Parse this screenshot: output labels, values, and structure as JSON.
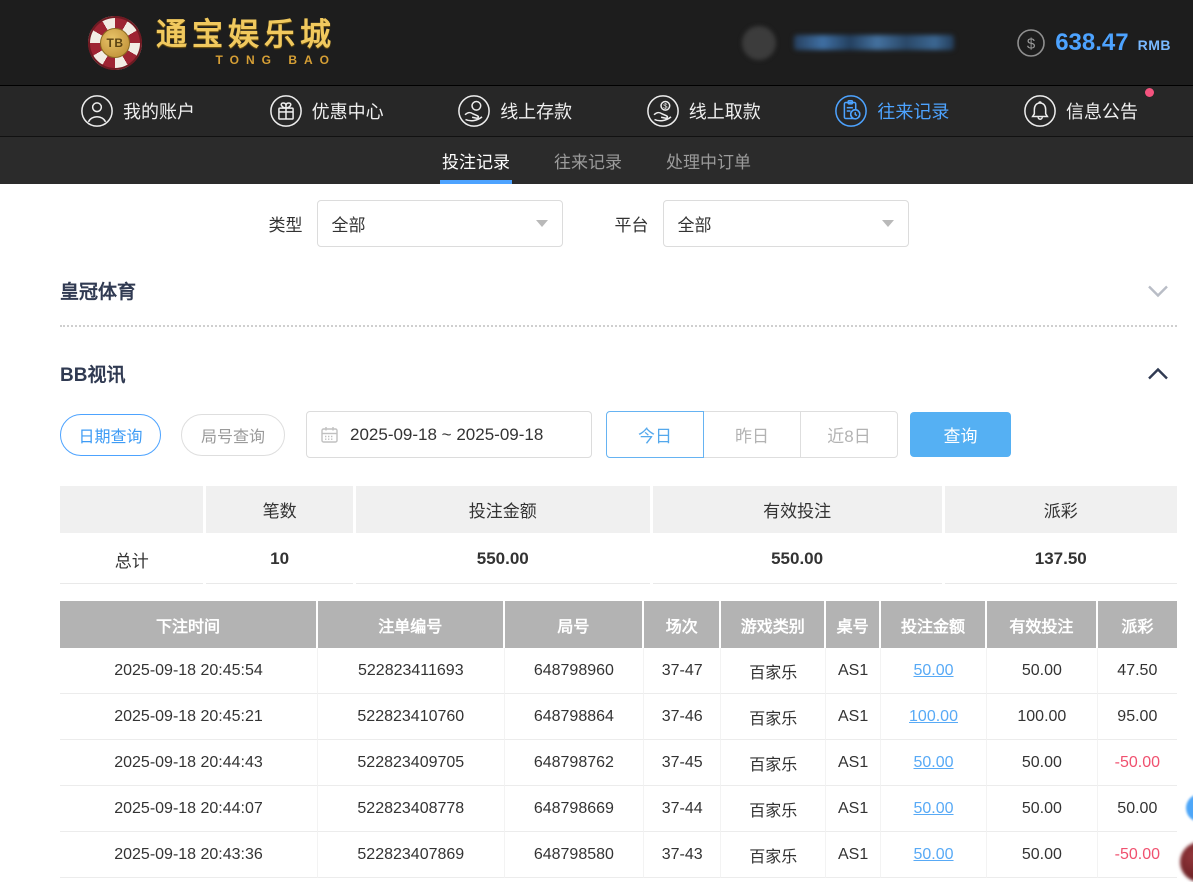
{
  "header": {
    "logo": {
      "chip": "TB",
      "title": "通宝娱乐城",
      "subtitle": "TONG BAO"
    },
    "balance": {
      "amount": "638.47",
      "currency": "RMB"
    }
  },
  "nav": {
    "items": [
      {
        "label": "我的账户",
        "icon": "user-icon",
        "active": false
      },
      {
        "label": "优惠中心",
        "icon": "gift-icon",
        "active": false
      },
      {
        "label": "线上存款",
        "icon": "deposit-icon",
        "active": false
      },
      {
        "label": "线上取款",
        "icon": "withdraw-icon",
        "active": false
      },
      {
        "label": "往来记录",
        "icon": "records-icon",
        "active": true
      },
      {
        "label": "信息公告",
        "icon": "bell-icon",
        "active": false,
        "has_badge": true
      }
    ]
  },
  "subtabs": [
    {
      "label": "投注记录",
      "active": true
    },
    {
      "label": "往来记录",
      "active": false
    },
    {
      "label": "处理中订单",
      "active": false
    }
  ],
  "filters": {
    "type": {
      "label": "类型",
      "value": "全部"
    },
    "platform": {
      "label": "平台",
      "value": "全部"
    }
  },
  "sections": {
    "crown": {
      "title": "皇冠体育",
      "state": "collapsed"
    },
    "bb": {
      "title": "BB视讯",
      "state": "expanded"
    }
  },
  "query": {
    "date_mode": "日期查询",
    "round_mode": "局号查询",
    "date_range": "2025-09-18 ~ 2025-09-18",
    "quick": [
      "今日",
      "昨日",
      "近8日"
    ],
    "quick_active": "今日",
    "submit": "查询"
  },
  "summary": {
    "headers": [
      "",
      "笔数",
      "投注金额",
      "有效投注",
      "派彩"
    ],
    "total_label": "总计",
    "values": [
      "10",
      "550.00",
      "550.00",
      "137.50"
    ]
  },
  "betTable": {
    "headers": [
      "下注时间",
      "注单编号",
      "局号",
      "场次",
      "游戏类别",
      "桌号",
      "投注金额",
      "有效投注",
      "派彩"
    ],
    "rows": [
      [
        "2025-09-18 20:45:54",
        "522823411693",
        "648798960",
        "37-47",
        "百家乐",
        "AS1",
        "50.00",
        "50.00",
        "47.50"
      ],
      [
        "2025-09-18 20:45:21",
        "522823410760",
        "648798864",
        "37-46",
        "百家乐",
        "AS1",
        "100.00",
        "100.00",
        "95.00"
      ],
      [
        "2025-09-18 20:44:43",
        "522823409705",
        "648798762",
        "37-45",
        "百家乐",
        "AS1",
        "50.00",
        "50.00",
        "-50.00"
      ],
      [
        "2025-09-18 20:44:07",
        "522823408778",
        "648798669",
        "37-44",
        "百家乐",
        "AS1",
        "50.00",
        "50.00",
        "50.00"
      ],
      [
        "2025-09-18 20:43:36",
        "522823407869",
        "648798580",
        "37-43",
        "百家乐",
        "AS1",
        "50.00",
        "50.00",
        "-50.00"
      ]
    ]
  },
  "colors": {
    "accent": "#4da3ff",
    "link": "#58aaf6",
    "button": "#55b0f3",
    "negative": "#f0516f",
    "badge": "#f4537e",
    "table_header": "#b3b3b3"
  }
}
